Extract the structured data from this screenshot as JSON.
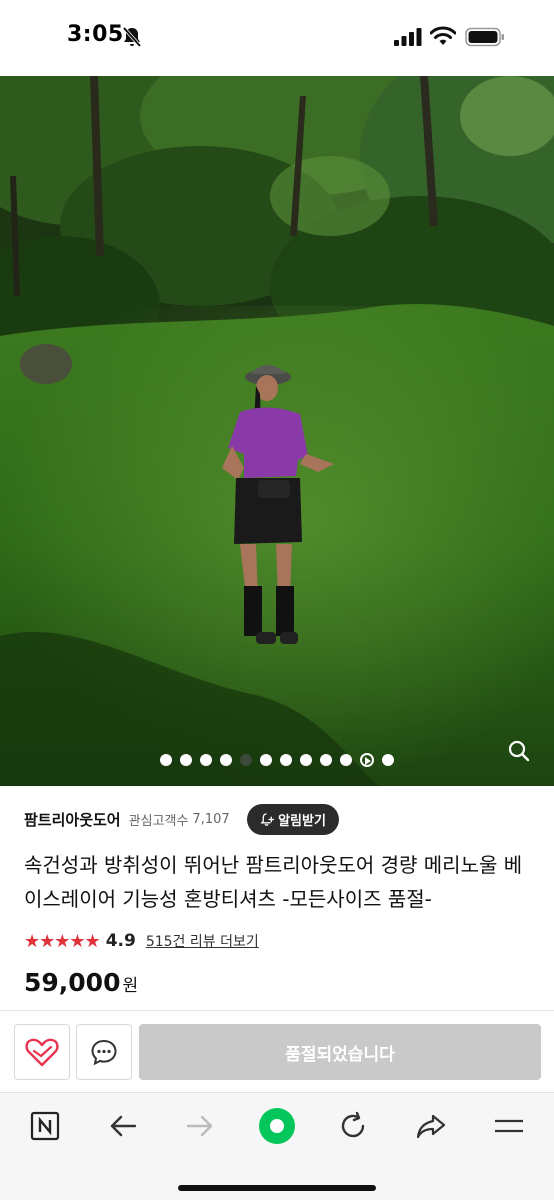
{
  "status_bar": {
    "time": "3:05",
    "icons": [
      "bell-slash-icon",
      "cellular-signal-icon",
      "wifi-icon",
      "battery-icon"
    ]
  },
  "gallery": {
    "slide_count": 12,
    "active_slide_index": 4,
    "video_slide_index": 10,
    "icons": [
      "zoom-icon",
      "play-icon"
    ]
  },
  "product": {
    "store_name": "팜트리아웃도어",
    "fans_label": "관심고객수",
    "fans_count": "7,107",
    "alarm_button": "알림받기",
    "title": "속건성과 방취성이 뛰어난 팜트리아웃도어 경량 메리노울 베이스레이어 기능성 혼방티셔츠 -모든사이즈 품절-",
    "stars": "★★★★★",
    "rating": "4.9",
    "review_link": "515건 리뷰 더보기",
    "price": "59,000",
    "currency": "원"
  },
  "action_bar": {
    "soldout_label": "품절되었습니다",
    "icons": [
      "heart-icon",
      "chat-icon"
    ]
  },
  "browser_toolbar": {
    "icons": [
      "naver-n-icon",
      "back-arrow-icon",
      "forward-arrow-icon",
      "green-dot-icon",
      "reload-icon",
      "share-icon",
      "menu-icon"
    ]
  },
  "colors": {
    "star_red": "#e0323a",
    "soldout_gray": "#c9c9c9",
    "alarm_dark": "#2b2b2b",
    "naver_green": "#03c75a",
    "heart_red": "#e8344e"
  }
}
